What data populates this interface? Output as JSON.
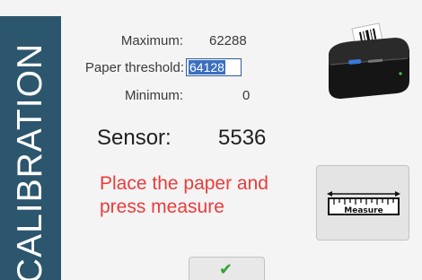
{
  "side_title": "CALIBRATION",
  "fields": {
    "maximum": {
      "label": "Maximum:",
      "value": "62288"
    },
    "paper_threshold": {
      "label": "Paper threshold:",
      "value": "64128"
    },
    "minimum": {
      "label": "Minimum:",
      "value": "0"
    }
  },
  "sensor": {
    "label": "Sensor:",
    "value": "5536"
  },
  "instruction": "Place the paper and press measure",
  "buttons": {
    "measure_label": "Measure",
    "ok_icon": "check-icon"
  },
  "printer_label": "Paper",
  "colors": {
    "banner": "#2c566d",
    "instruction": "#ea3b3b",
    "check": "#2ea52e",
    "selection": "#3b6fbf"
  }
}
